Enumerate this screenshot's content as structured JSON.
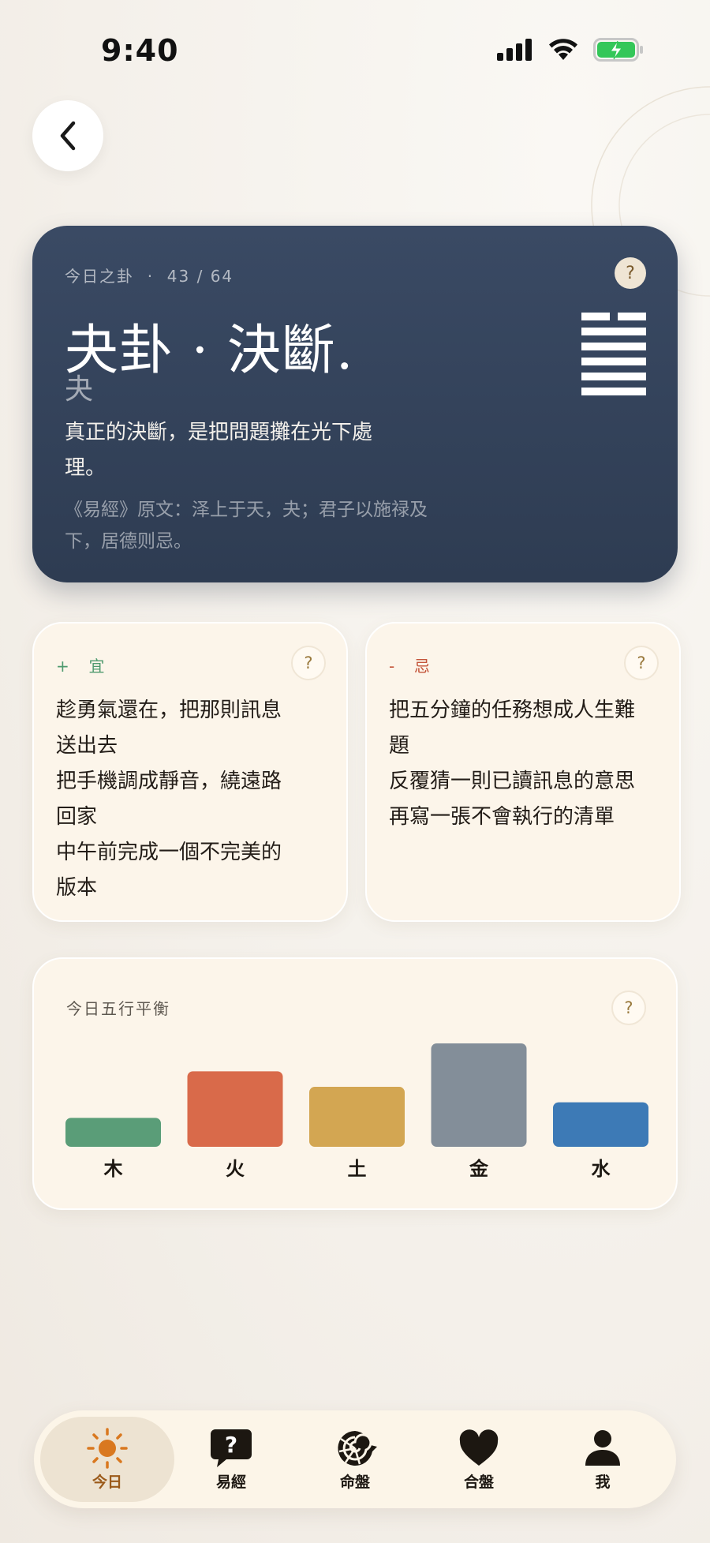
{
  "status_bar": {
    "time": "9:40"
  },
  "hexagram": {
    "eyebrow": "今日之卦  ·  43 / 64",
    "title": "夬卦 · 決斷.",
    "char": "夬",
    "quote": "真正的決斷，是把問題攤在光下處理。",
    "source": "《易經》原文：泽上于天，夬；君子以施禄及下，居德则忌。",
    "help": "?",
    "lines": [
      "yin",
      "yang",
      "yang",
      "yang",
      "yang",
      "yang"
    ]
  },
  "do_card": {
    "label": "+  宜",
    "help": "?",
    "items": [
      "趁勇氣還在，把那則訊息送出去",
      "把手機調成靜音，繞遠路回家",
      "中午前完成一個不完美的版本"
    ]
  },
  "dont_card": {
    "label": "-  忌",
    "help": "?",
    "items": [
      "把五分鐘的任務想成人生難題",
      "反覆猜一則已讀訊息的意思",
      "再寫一張不會執行的清單"
    ]
  },
  "elements_card": {
    "title": "今日五行平衡",
    "help": "?"
  },
  "chart_data": {
    "type": "bar",
    "title": "今日五行平衡",
    "categories": [
      "木",
      "火",
      "土",
      "金",
      "水"
    ],
    "values": [
      0.28,
      0.73,
      0.58,
      1.0,
      0.43
    ],
    "colors": [
      "#5a9d78",
      "#d96a4a",
      "#d3a652",
      "#838e99",
      "#3d7ab6"
    ],
    "ylim": [
      0,
      1
    ],
    "grid": false
  },
  "tabs": [
    {
      "label": "今日",
      "icon": "sun-icon",
      "active": true
    },
    {
      "label": "易經",
      "icon": "question-bubble-icon",
      "active": false
    },
    {
      "label": "命盤",
      "icon": "nautilus-shell-icon",
      "active": false
    },
    {
      "label": "合盤",
      "icon": "heart-icon",
      "active": false
    },
    {
      "label": "我",
      "icon": "person-icon",
      "active": false
    }
  ],
  "colors": {
    "accent": "#9b5a1a",
    "card_dark": "#34435b",
    "do_green": "#4e9a6e",
    "dont_red": "#c4553b",
    "battery_green": "#34c759"
  }
}
